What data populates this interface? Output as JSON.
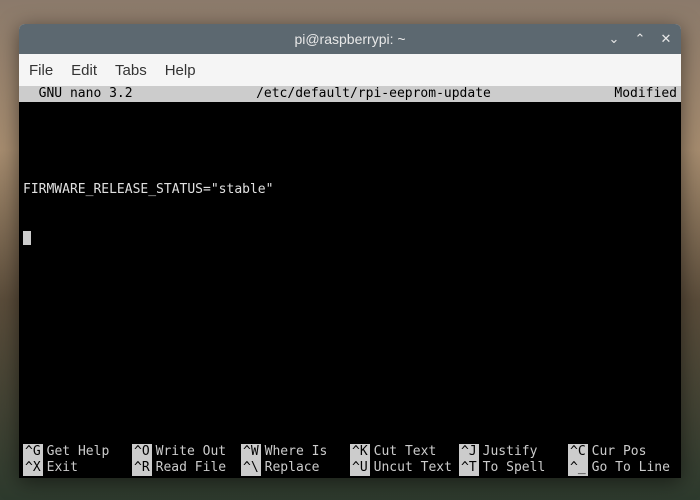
{
  "window": {
    "title": "pi@raspberrypi: ~"
  },
  "menubar": {
    "file": "File",
    "edit": "Edit",
    "tabs": "Tabs",
    "help": "Help"
  },
  "nano": {
    "header": {
      "version": "  GNU nano 3.2",
      "filepath": "/etc/default/rpi-eeprom-update",
      "status": "Modified"
    },
    "content_line1": "FIRMWARE_RELEASE_STATUS=\"stable\"",
    "footer": {
      "row1": [
        {
          "key": "^G",
          "label": "Get Help"
        },
        {
          "key": "^O",
          "label": "Write Out"
        },
        {
          "key": "^W",
          "label": "Where Is"
        },
        {
          "key": "^K",
          "label": "Cut Text"
        },
        {
          "key": "^J",
          "label": "Justify"
        },
        {
          "key": "^C",
          "label": "Cur Pos"
        }
      ],
      "row2": [
        {
          "key": "^X",
          "label": "Exit"
        },
        {
          "key": "^R",
          "label": "Read File"
        },
        {
          "key": "^\\",
          "label": "Replace"
        },
        {
          "key": "^U",
          "label": "Uncut Text"
        },
        {
          "key": "^T",
          "label": "To Spell"
        },
        {
          "key": "^_",
          "label": "Go To Line"
        }
      ]
    }
  }
}
